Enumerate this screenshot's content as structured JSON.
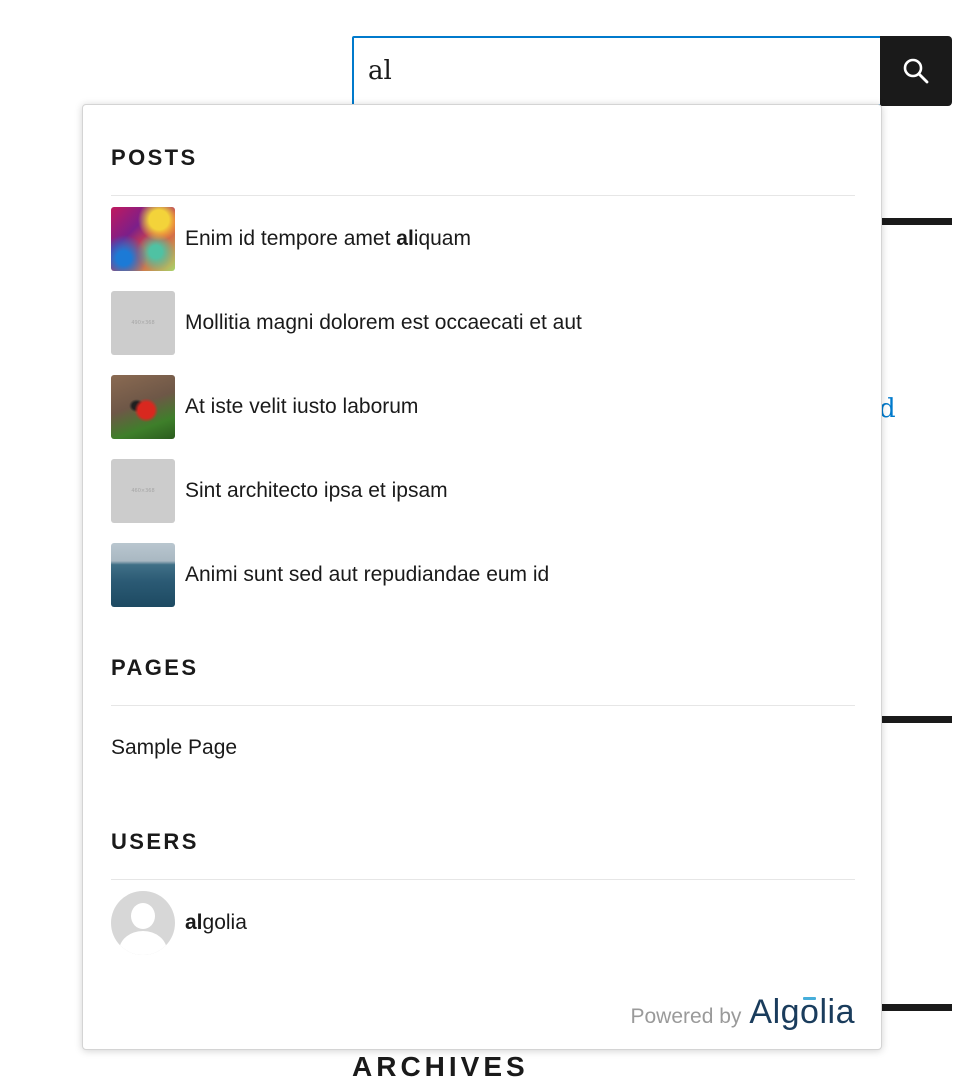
{
  "search": {
    "value": "al",
    "button_icon": "search-icon"
  },
  "background": {
    "link_fragment": "d",
    "heading_fragment": "ARCHIVES"
  },
  "posts": {
    "header": "POSTS",
    "items": [
      {
        "highlight": "",
        "before": "Enim id tempore amet ",
        "match": "al",
        "after": "iquam",
        "thumb": "colorful"
      },
      {
        "before": "Mollitia magni dolorem est occaecati et aut",
        "match": "",
        "after": "",
        "thumb": "placeholder",
        "thumb_text": "490×368"
      },
      {
        "before": "At iste velit iusto laborum",
        "match": "",
        "after": "",
        "thumb": "moto"
      },
      {
        "before": "Sint architecto ipsa et ipsam",
        "match": "",
        "after": "",
        "thumb": "placeholder",
        "thumb_text": "460×368"
      },
      {
        "before": "Animi sunt sed aut repudiandae eum id",
        "match": "",
        "after": "",
        "thumb": "sea"
      }
    ]
  },
  "pages": {
    "header": "PAGES",
    "items": [
      {
        "label": "Sample Page"
      }
    ]
  },
  "users": {
    "header": "USERS",
    "items": [
      {
        "match": "al",
        "after": "golia",
        "avatar": "default-avatar-icon"
      }
    ]
  },
  "footer": {
    "powered_by": "Powered by",
    "brand": "Algolia",
    "brand_parts": [
      "Alg",
      "o",
      "lia"
    ]
  },
  "colors": {
    "accent": "#007acc",
    "dark": "#1a1a1a",
    "brand": "#1a3c5c",
    "brand_accent": "#46aeda"
  }
}
